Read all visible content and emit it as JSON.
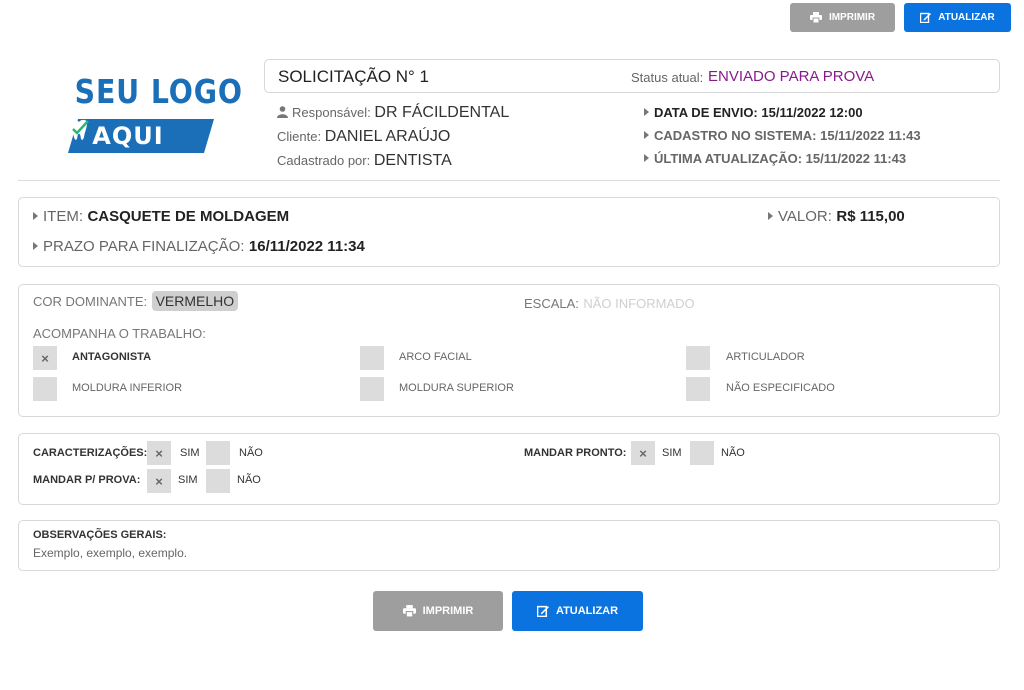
{
  "actions": {
    "print_label": "IMPRIMIR",
    "update_label": "ATUALIZAR"
  },
  "logo": {
    "line1": "SEU LOGO",
    "line2": "AQUI"
  },
  "header": {
    "request_title": "SOLICITAÇÃO N° 1",
    "status_label": "Status atual:",
    "status_value": "ENVIADO PARA PROVA"
  },
  "details_left": {
    "responsible_label": "Responsável:",
    "responsible_value": "DR FÁCILDENTAL",
    "client_label": "Cliente:",
    "client_value": "DANIEL ARAÚJO",
    "registered_by_label": "Cadastrado por:",
    "registered_by_value": "DENTISTA"
  },
  "details_right": {
    "sent_date": "DATA DE ENVIO: 15/11/2022 12:00",
    "system_registration": "CADASTRO NO SISTEMA: 15/11/2022 11:43",
    "last_update": "ÚLTIMA ATUALIZAÇÃO: 15/11/2022 11:43"
  },
  "item": {
    "item_label": "ITEM:",
    "item_value": "CASQUETE DE MOLDAGEM",
    "value_label": "VALOR:",
    "value_value": "R$ 115,00",
    "deadline_label": "PRAZO PARA FINALIZAÇÃO:",
    "deadline_value": "16/11/2022 11:34"
  },
  "color": {
    "dominant_label": "COR DOMINANTE:",
    "dominant_value": "VERMELHO",
    "scale_label": "ESCALA:",
    "scale_value": "NÃO INFORMADO",
    "accompanies_label": "ACOMPANHA O TRABALHO:",
    "options": [
      {
        "label": "ANTAGONISTA",
        "checked": true
      },
      {
        "label": "ARCO FACIAL",
        "checked": false
      },
      {
        "label": "ARTICULADOR",
        "checked": false
      },
      {
        "label": "MOLDURA INFERIOR",
        "checked": false
      },
      {
        "label": "MOLDURA SUPERIOR",
        "checked": false
      },
      {
        "label": "NÃO ESPECIFICADO",
        "checked": false
      }
    ]
  },
  "characterizations": {
    "charac_label": "CARACTERIZAÇÕES:",
    "send_ready_label": "MANDAR PRONTO:",
    "send_trial_label": "MANDAR P/ PROVA:",
    "yes": "SIM",
    "no": "NÃO",
    "check_mark": "×"
  },
  "observations": {
    "label": "OBSERVAÇÕES GERAIS:",
    "value": "Exemplo, exemplo, exemplo."
  }
}
